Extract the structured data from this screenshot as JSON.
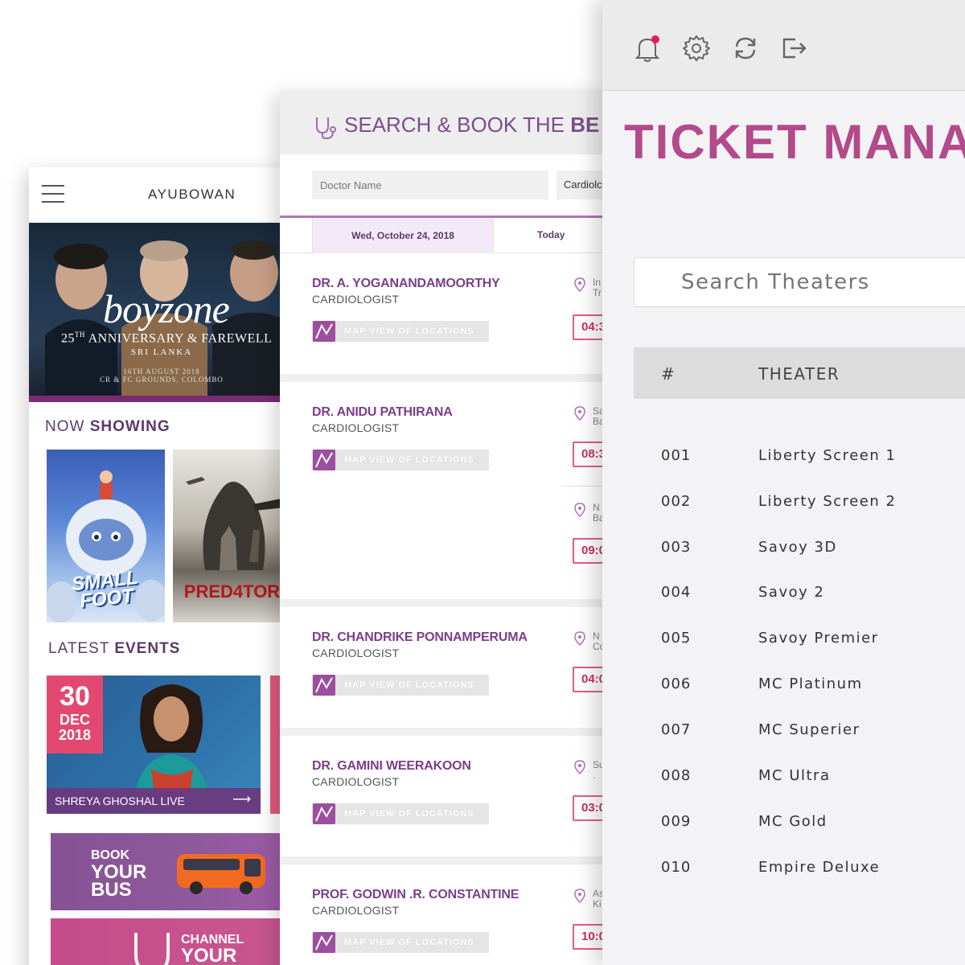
{
  "mobile": {
    "brand": "AYUBOWAN",
    "banner": {
      "band": "boyzone",
      "subtitle_num": "25",
      "subtitle_sup": "TH",
      "subtitle_rest": "ANNIVERSARY & FAREWELL",
      "location": "SRI LANKA",
      "date_line": "16TH AUGUST 2018",
      "venue_line": "CR & FC GROUNDS, COLOMBO"
    },
    "now_showing": {
      "prefix": "NOW",
      "bold": "SHOWING"
    },
    "posters": [
      {
        "title_line1": "SMALL",
        "title_line2": "FOOT"
      },
      {
        "title": "PRED4TOR"
      }
    ],
    "latest_events": {
      "prefix": "LATEST",
      "bold": "EVENTS"
    },
    "event": {
      "day": "30",
      "month": "DEC",
      "year": "2018",
      "label": "SHREYA GHOSHAL LIVE"
    },
    "bus": {
      "line1": "BOOK",
      "line2": "YOUR",
      "line3": "BUS"
    },
    "channel": {
      "line1": "CHANNEL",
      "line2": "YOUR"
    },
    "colors": {
      "accent": "#7a2b73",
      "event_date": "#e34870"
    }
  },
  "doctor": {
    "title_light": "SEARCH & BOOK THE ",
    "title_bold": "BE",
    "name_placeholder": "Doctor Name",
    "specialty_value": "Cardiolc",
    "selected_date": "Wed, October 24, 2018",
    "today_label": "Today",
    "map_label": "MAP VIEW OF LOCATIONS",
    "cards": [
      {
        "name": "DR. A. YOGANANDAMOORTHY",
        "role": "CARDIOLOGIST",
        "loc1": "In",
        "loc2": "Tr",
        "time": "04:3"
      },
      {
        "name": "DR. ANIDU PATHIRANA",
        "role": "CARDIOLOGIST",
        "loc1": "Sa",
        "loc2": "Ba",
        "time": "08:3",
        "loc3": "N",
        "loc4": "Ba",
        "time2": "09:0"
      },
      {
        "name": "DR. CHANDRIKE PONNAMPERUMA",
        "role": "CARDIOLOGIST",
        "loc1": "N",
        "loc2": "Co",
        "time": "04:0"
      },
      {
        "name": "DR. GAMINI WEERAKOON",
        "role": "CARDIOLOGIST",
        "loc1": "Su",
        "loc2": ".",
        "time": "03:0"
      },
      {
        "name": "PROF. GODWIN .R. CONSTANTINE",
        "role": "CARDIOLOGIST",
        "loc1": "As",
        "loc2": "Ki",
        "time": "10:0"
      }
    ],
    "colors": {
      "accent": "#7b3f89",
      "time_border": "#e35b86"
    }
  },
  "ticket": {
    "title": "TICKET MANA",
    "search_placeholder": "Search Theaters",
    "col_num": "#",
    "col_theater": "THEATER",
    "rows": [
      {
        "num": "001",
        "name": "Liberty Screen 1"
      },
      {
        "num": "002",
        "name": "Liberty Screen 2"
      },
      {
        "num": "003",
        "name": "Savoy 3D"
      },
      {
        "num": "004",
        "name": "Savoy 2"
      },
      {
        "num": "005",
        "name": "Savoy Premier"
      },
      {
        "num": "006",
        "name": "MC Platinum"
      },
      {
        "num": "007",
        "name": "MC Superier"
      },
      {
        "num": "008",
        "name": "MC Ultra"
      },
      {
        "num": "009",
        "name": "MC Gold"
      },
      {
        "num": "010",
        "name": "Empire Deluxe"
      }
    ],
    "icons": [
      "bell-icon",
      "gear-icon",
      "refresh-icon",
      "logout-icon"
    ],
    "colors": {
      "title": "#b24a8b",
      "notification_dot": "#e01d5a"
    }
  }
}
